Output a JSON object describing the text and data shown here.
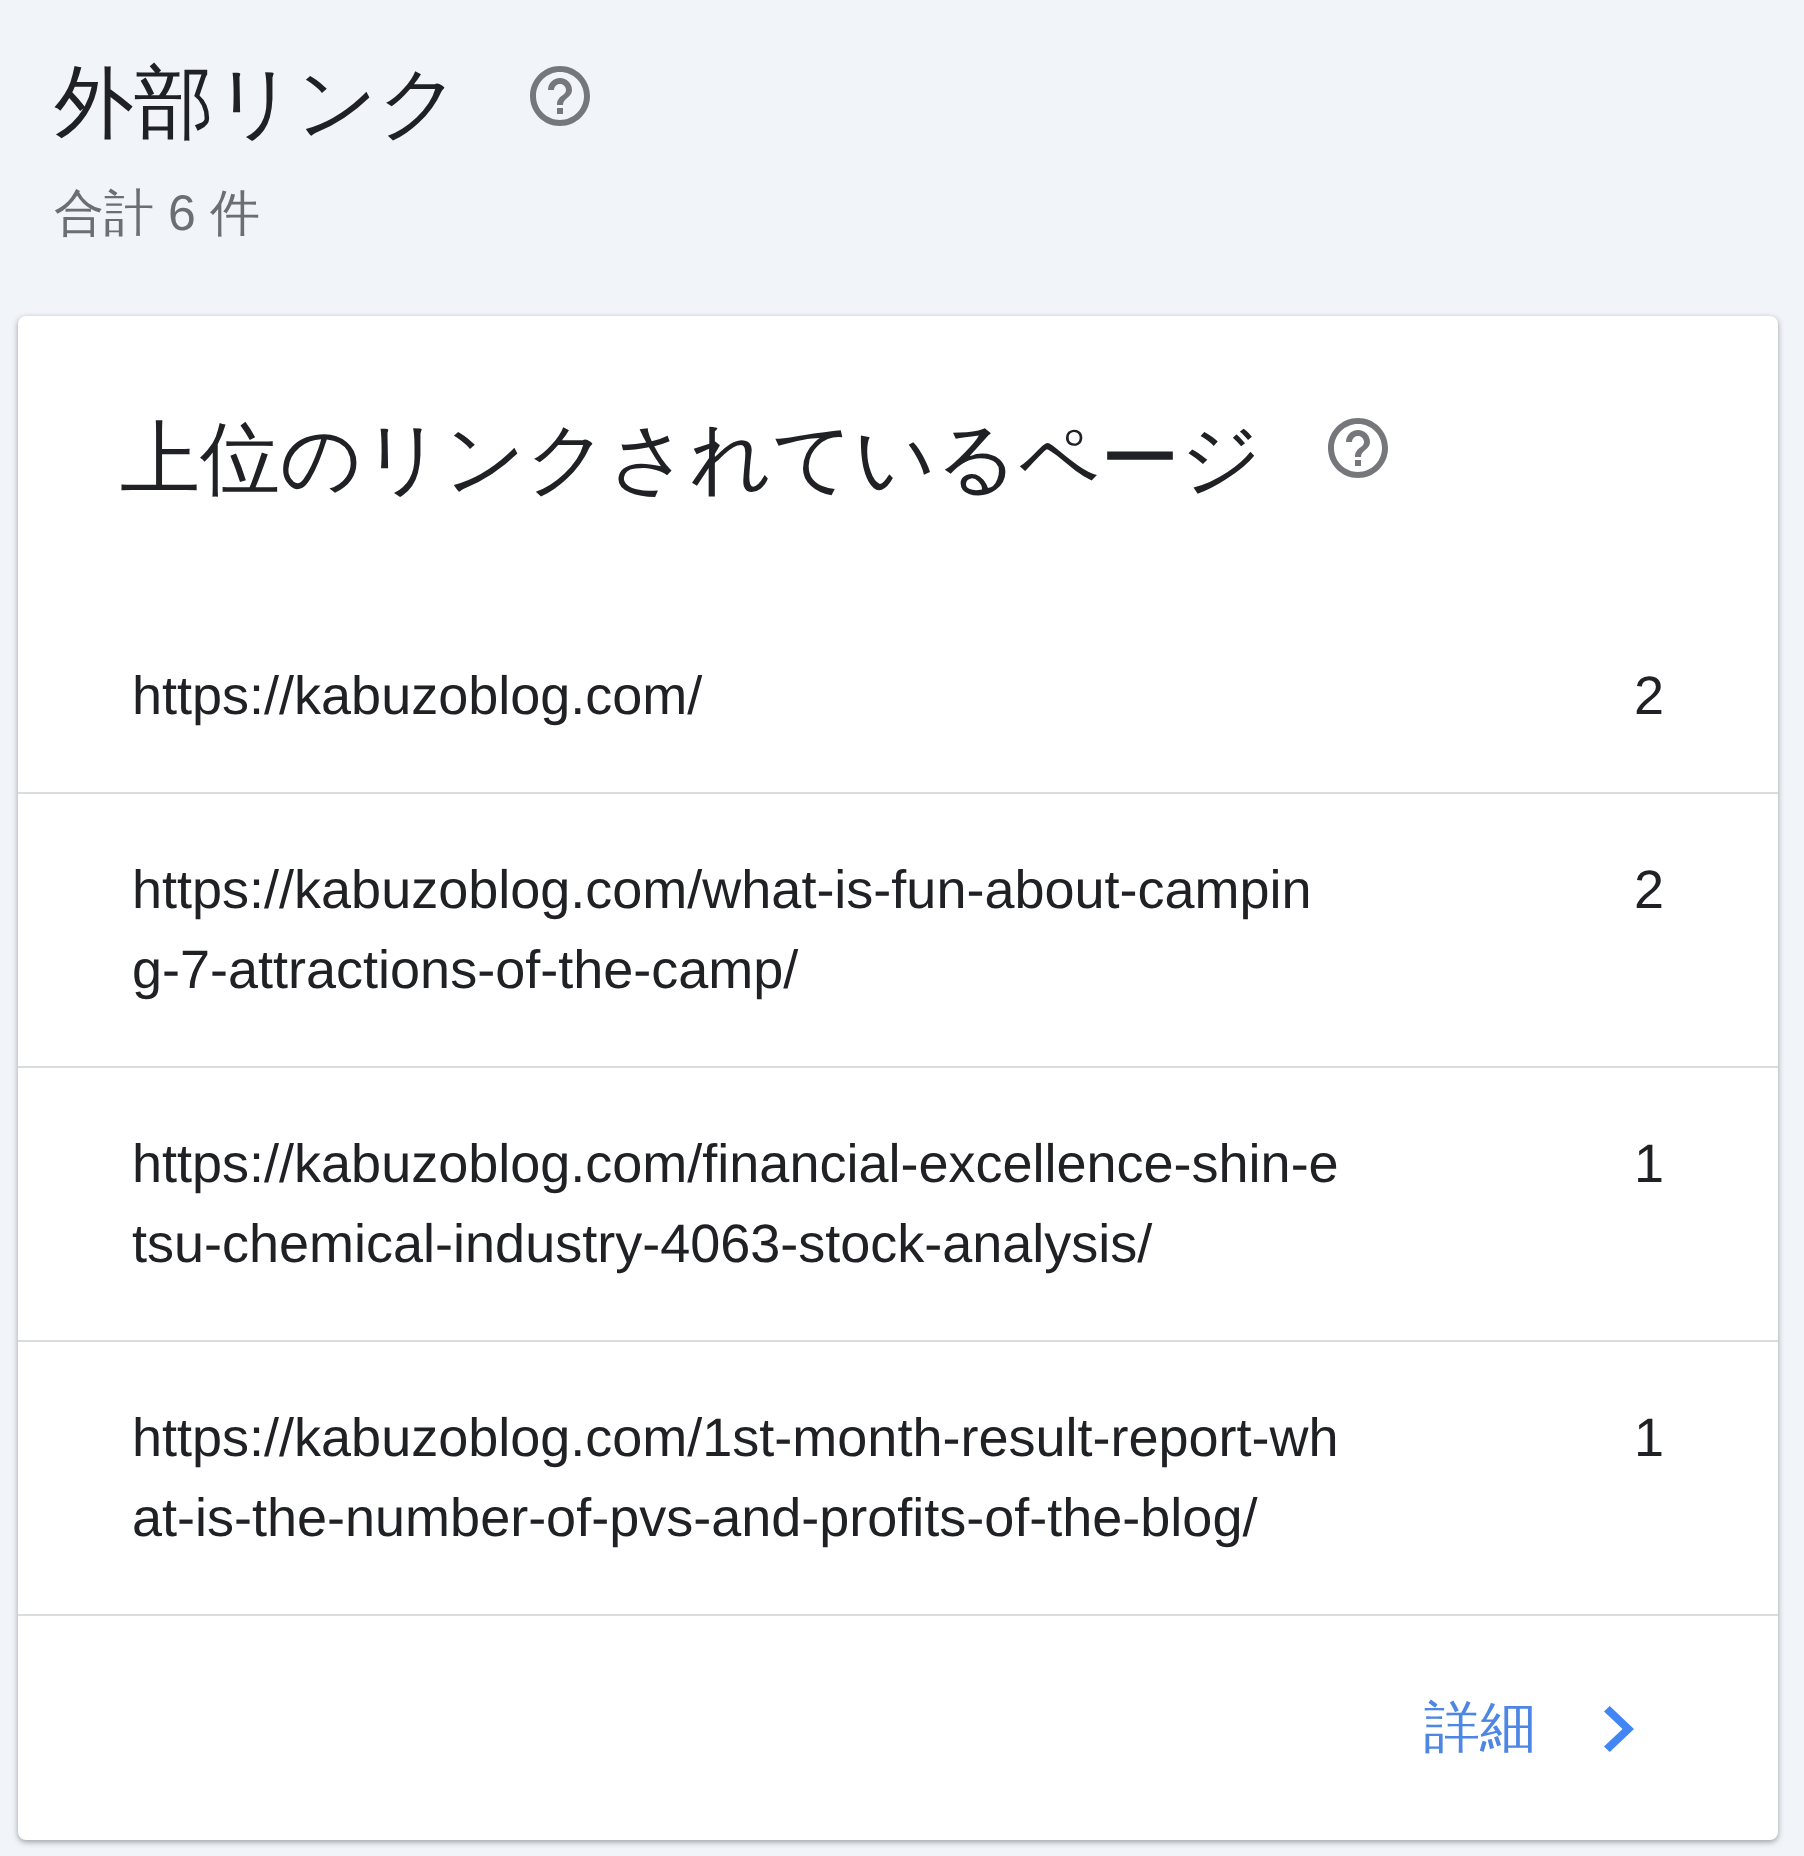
{
  "header": {
    "title": "外部リンク",
    "total": "合計 6 件"
  },
  "top_linked_pages": {
    "title": "上位のリンクされているページ",
    "rows": [
      {
        "url": "https://kabuzoblog.com/",
        "count": "2"
      },
      {
        "url": "https://kabuzoblog.com/what-is-fun-about-camping-7-attractions-of-the-camp/",
        "count": "2"
      },
      {
        "url": "https://kabuzoblog.com/financial-excellence-shin-etsu-chemical-industry-4063-stock-analysis/",
        "count": "1"
      },
      {
        "url": "https://kabuzoblog.com/1st-month-result-report-what-is-the-number-of-pvs-and-profits-of-the-blog/",
        "count": "1"
      }
    ],
    "more_link": "詳細"
  }
}
